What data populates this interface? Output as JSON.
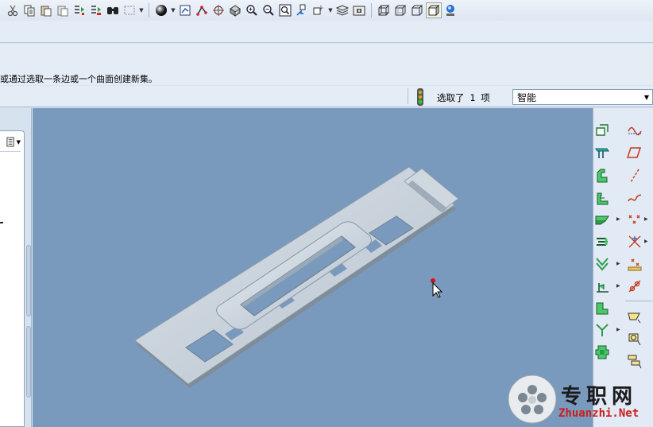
{
  "toolbar": {
    "icons": [
      "scissors-icon",
      "copy-icon",
      "paste-icon",
      "paste-special-icon",
      "regenerate-icon",
      "regen-manager-icon",
      "find-icon",
      "select-box-icon",
      "shading-sphere-icon",
      "refit-icon",
      "datum-display-icon",
      "spin-center-icon",
      "orient-icon",
      "zoom-in-icon",
      "zoom-out-icon",
      "zoom-fit-icon",
      "reorient-icon",
      "saved-views-icon",
      "layers-icon",
      "view-manager-icon",
      "wireframe-icon",
      "hidden-line-icon",
      "no-hidden-icon",
      "shaded-icon",
      "help-icon"
    ]
  },
  "message": {
    "text": "或通过选取一条边或一个曲面创建新集。"
  },
  "status": {
    "selection_text": "选取了 1 项",
    "filter_value": "智能"
  },
  "right_toolbar": {
    "icons": [
      "datum-plane-icon",
      "sketch-curve-icon",
      "extrude-icon",
      "sketch-icon",
      "revolve-icon",
      "datum-axis-icon",
      "blend-icon",
      "datum-curve-icon",
      "flange-icon",
      "datum-point-icon",
      "unbend-icon",
      "datum-csys-icon",
      "bend-icon",
      "analysis-icon",
      "form-icon",
      "insert-feature-icon",
      "corner-relief-icon",
      "annotation-icon",
      "rip-icon",
      "ucs-icon",
      "flatten-icon",
      "model-tree-icon"
    ]
  },
  "watermark": {
    "title": "专职网",
    "url": "Zhuanzhi.Net"
  }
}
